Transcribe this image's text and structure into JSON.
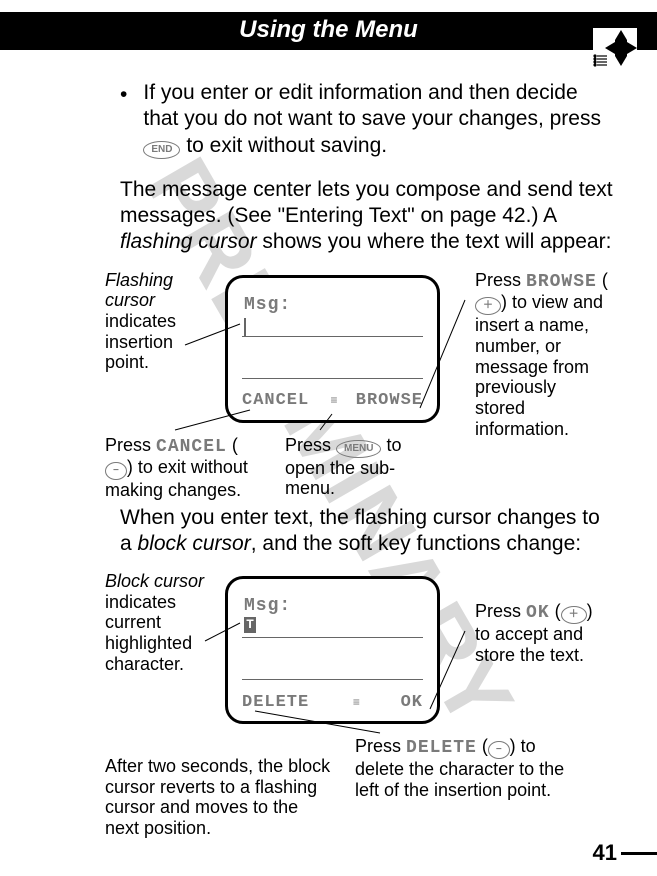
{
  "watermark": "PRELIMINARY",
  "header": {
    "title": "Using the Menu"
  },
  "bullet": "If you enter or edit information and then decide that you do not want to save your changes, press ",
  "bullet_tail": " to exit without saving.",
  "end_key": "END",
  "para1_a": "The message center lets you compose and send text messages. (See \"Entering Text\" on page 42.) A ",
  "para1_b": "flashing cursor",
  "para1_c": " shows you where the text will appear:",
  "screen1": {
    "msg": "Msg:",
    "left": "CANCEL",
    "right": "BROWSE"
  },
  "callouts1": {
    "flashing_a": "Flashing cursor",
    "flashing_b": " indicates insertion point.",
    "browse_a": "Press ",
    "browse_b": "BROWSE",
    "browse_c": " to view and insert a name, number, or message from previously stored information.",
    "cancel_a": "Press ",
    "cancel_b": "CANCEL",
    "cancel_c": " to exit without making changes.",
    "menu_a": "Press ",
    "menu_b": " to open the sub-menu.",
    "menu_key": "MENU"
  },
  "keys": {
    "plus": "＋",
    "minus": "−"
  },
  "para2_a": "When you enter text, the flashing cursor changes to a ",
  "para2_b": "block cursor",
  "para2_c": ", and the soft key functions change:",
  "screen2": {
    "msg": "Msg:",
    "char": "T",
    "left": "DELETE",
    "right": "OK"
  },
  "callouts2": {
    "block_a": "Block cursor",
    "block_b": " indicates current highlighted character.",
    "ok_a": "Press ",
    "ok_b": "OK",
    "ok_c": " to accept and store the text.",
    "delete_a": "Press ",
    "delete_b": "DELETE",
    "delete_c": " to delete the character to the left of the insertion point.",
    "after": "After two seconds, the block cursor reverts to a flashing cursor and moves to the next position."
  },
  "page_number": "41"
}
